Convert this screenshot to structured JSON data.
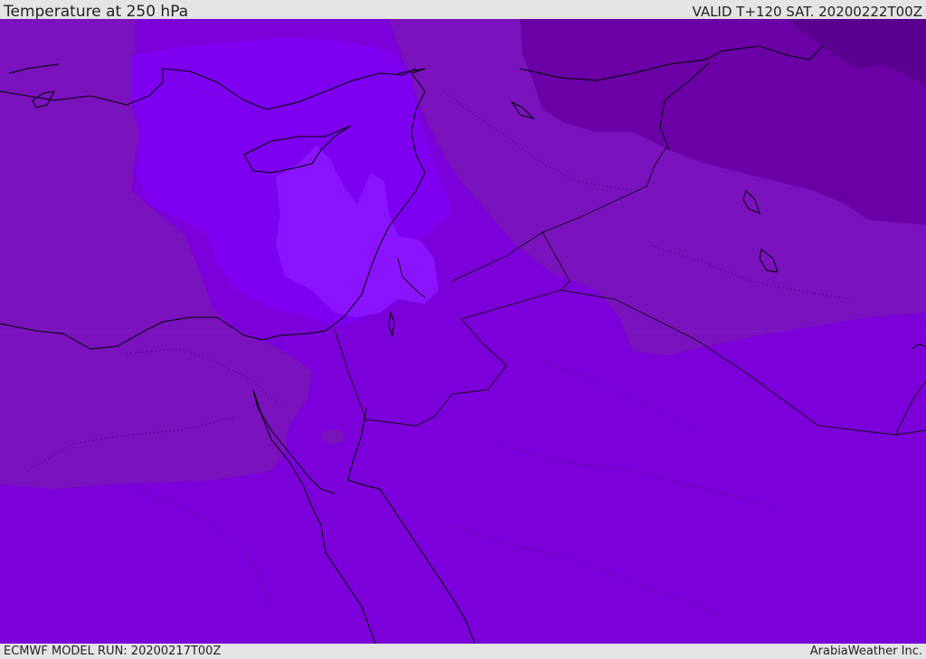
{
  "header": {
    "title": "Temperature at 250 hPa",
    "valid": "VALID T+120 SAT. 20200222T00Z"
  },
  "footer": {
    "model_run": "ECMWF MODEL RUN: 20200217T00Z",
    "credit": "ArabiaWeather Inc."
  },
  "map": {
    "colors": {
      "background_band": "#7b00d9",
      "mid_band": "#7a12be",
      "warm_band": "#7e00f0",
      "warmest_band": "#8a14ff",
      "cold_band": "#6a00a6",
      "coldest_band": "#5a0090",
      "coastline": "#000000",
      "border": "#111111"
    }
  }
}
